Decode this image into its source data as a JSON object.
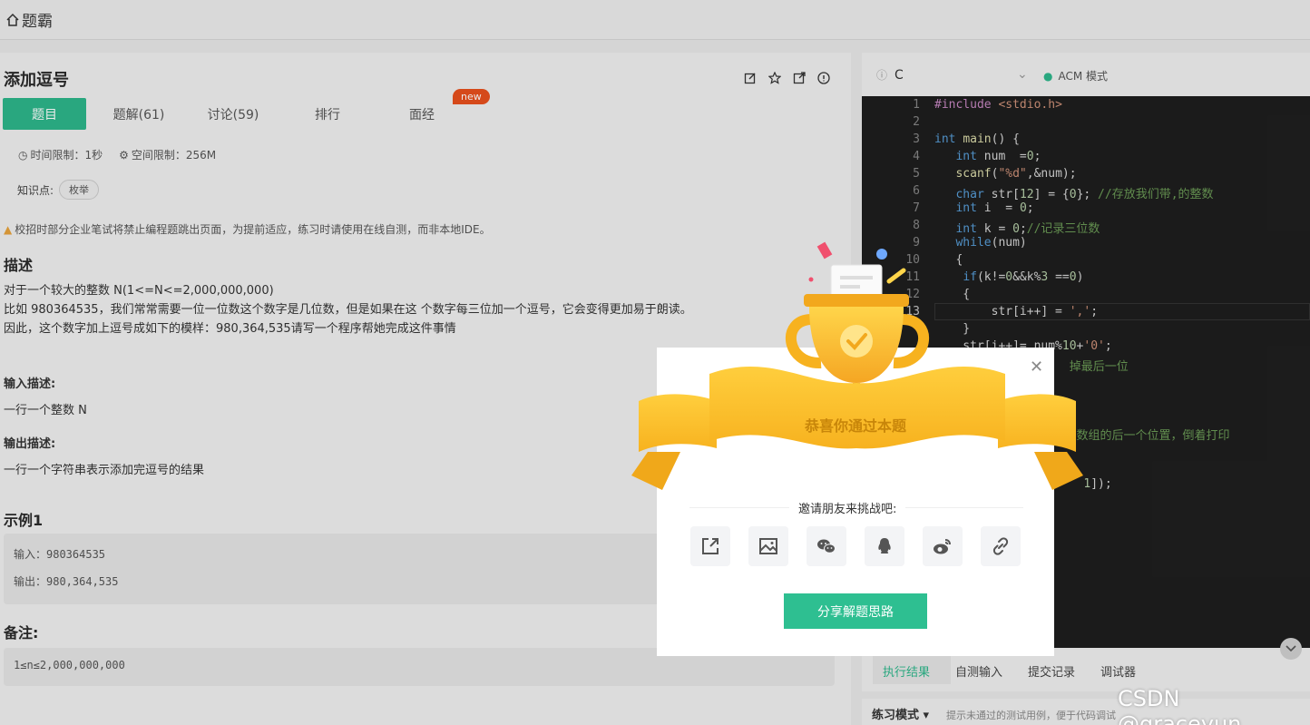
{
  "topbar": {
    "brand": "题霸"
  },
  "problem": {
    "title": "添加逗号",
    "tabs": [
      {
        "label": "题目"
      },
      {
        "label": "题解(61)"
      },
      {
        "label": "讨论(59)"
      },
      {
        "label": "排行"
      },
      {
        "label": "面经"
      }
    ],
    "new_badge": "new",
    "time_limit": "时间限制：1秒",
    "space_limit": "空间限制：256M",
    "knowledge_label": "知识点:",
    "knowledge_tag": "枚举",
    "warning": "校招时部分企业笔试将禁止编程题跳出页面，为提前适应，练习时请使用在线自测，而非本地IDE。",
    "desc_heading": "描述",
    "desc_lines": [
      "对于一个较大的整数 N(1<=N<=2,000,000,000)",
      "比如 980364535，我们常常需要一位一位数这个数字是几位数，但是如果在这 个数字每三位加一个逗号，它会变得更加易于朗读。",
      "因此，这个数字加上逗号成如下的模样：980,364,535请写一个程序帮她完成这件事情"
    ],
    "input_heading": "输入描述:",
    "input_text": "一行一个整数 N",
    "output_heading": "输出描述:",
    "output_text": "一行一个字符串表示添加完逗号的结果",
    "example_heading": "示例1",
    "example_input": "输入：980364535",
    "example_output": "输出：980,364,535",
    "note_heading": "备注:",
    "note_text": "1≤n≤2,000,000,000"
  },
  "editor": {
    "language": "C",
    "mode": "ACM 模式",
    "line_numbers": [
      "1",
      "2",
      "3",
      "4",
      "5",
      "6",
      "7",
      "8",
      "9",
      "10",
      "11",
      "12",
      "13"
    ],
    "bottom_tabs": [
      "执行结果",
      "自测输入",
      "提交记录",
      "调试器"
    ],
    "practice_mode": "练习模式",
    "practice_hint": "提示未通过的测试用例，便于代码调试"
  },
  "modal": {
    "congrats": "恭喜你通过本题",
    "invite": "邀请朋友来挑战吧:",
    "share_button": "分享解题思路",
    "share_icons": [
      "external-share-icon",
      "image-icon",
      "wechat-icon",
      "qq-icon",
      "weibo-icon",
      "link-icon"
    ]
  },
  "watermark": "CSDN @graceyun",
  "colors": {
    "accent": "#2db68a",
    "badge": "#e8501d",
    "gold": "#f5b82e"
  }
}
